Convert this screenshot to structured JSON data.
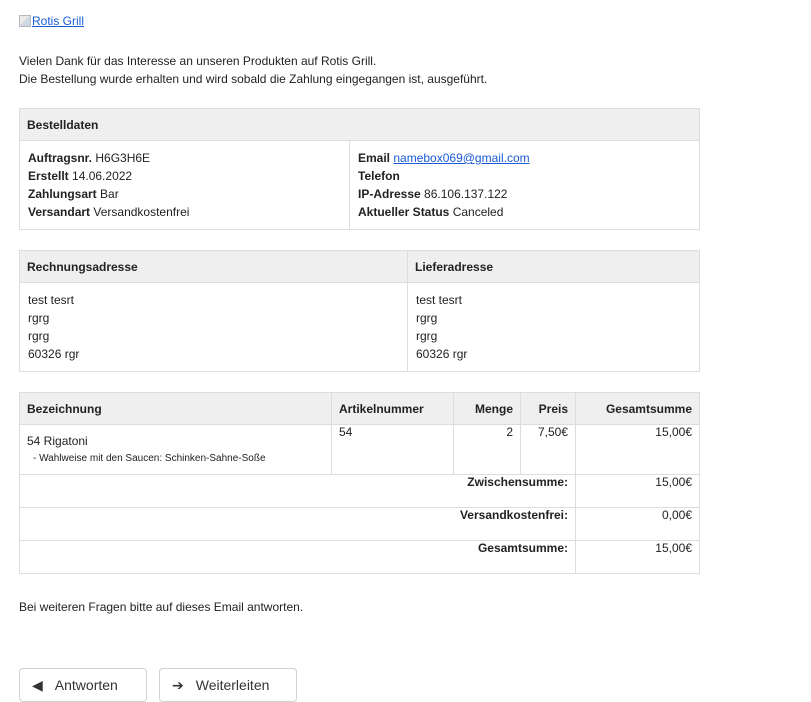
{
  "logo": {
    "alt": "Rotis Grill"
  },
  "intro": {
    "line1": "Vielen Dank für das Interesse an unseren Produkten auf Rotis Grill.",
    "line2": "Die Bestellung wurde erhalten und wird sobald die Zahlung eingegangen ist, ausgeführt."
  },
  "order": {
    "header": "Bestelldaten",
    "left": [
      {
        "label": "Auftragsnr.",
        "value": "H6G3H6E"
      },
      {
        "label": "Erstellt",
        "value": "14.06.2022"
      },
      {
        "label": "Zahlungsart",
        "value": "Bar"
      },
      {
        "label": "Versandart",
        "value": "Versandkostenfrei"
      }
    ],
    "right": [
      {
        "label": "Email",
        "value": "namebox069@gmail.com"
      },
      {
        "label": "Telefon",
        "value": ""
      },
      {
        "label": "IP-Adresse",
        "value": "86.106.137.122"
      },
      {
        "label": "Aktueller Status",
        "value": "Canceled"
      }
    ]
  },
  "addresses": {
    "billing_header": "Rechnungsadresse",
    "shipping_header": "Lieferadresse",
    "billing": [
      "test tesrt",
      "rgrg",
      "rgrg",
      "60326 rgr"
    ],
    "shipping": [
      "test tesrt",
      "rgrg",
      "rgrg",
      "60326 rgr"
    ]
  },
  "items": {
    "columns": [
      "Bezeichnung",
      "Artikelnummer",
      "Menge",
      "Preis",
      "Gesamtsumme"
    ],
    "rows": [
      {
        "name": "54 Rigatoni",
        "option": "- Wahlweise mit den Saucen: Schinken-Sahne-Soße",
        "sku": "54",
        "qty": "2",
        "price": "7,50€",
        "total": "15,00€"
      }
    ],
    "subtotal_label": "Zwischensumme:",
    "subtotal": "15,00€",
    "shipping_label": "Versandkostenfrei:",
    "shipping": "0,00€",
    "grand_label": "Gesamtsumme:",
    "grand": "15,00€"
  },
  "footer": {
    "note": "Bei weiteren Fragen bitte auf dieses Email antworten."
  },
  "actions": {
    "reply": "Antworten",
    "forward": "Weiterleiten"
  },
  "colors": {
    "link": "#1a5bd8",
    "header_bg": "#efefef",
    "border": "#dddddd"
  }
}
